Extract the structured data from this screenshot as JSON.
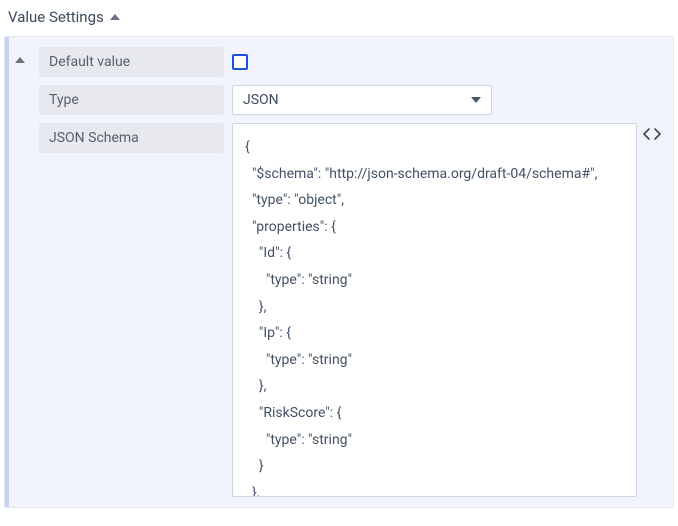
{
  "section": {
    "title": "Value Settings"
  },
  "fields": {
    "defaultValue": {
      "label": "Default value",
      "checked": false
    },
    "type": {
      "label": "Type",
      "selected": "JSON"
    },
    "schema": {
      "label": "JSON Schema",
      "content": "{\n  \"$schema\": \"http://json-schema.org/draft-04/schema#\",\n  \"type\": \"object\",\n  \"properties\": {\n    \"Id\": {\n      \"type\": \"string\"\n    },\n    \"Ip\": {\n      \"type\": \"string\"\n    },\n    \"RiskScore\": {\n      \"type\": \"string\"\n    }\n  },\n  \"required\": ["
    }
  }
}
